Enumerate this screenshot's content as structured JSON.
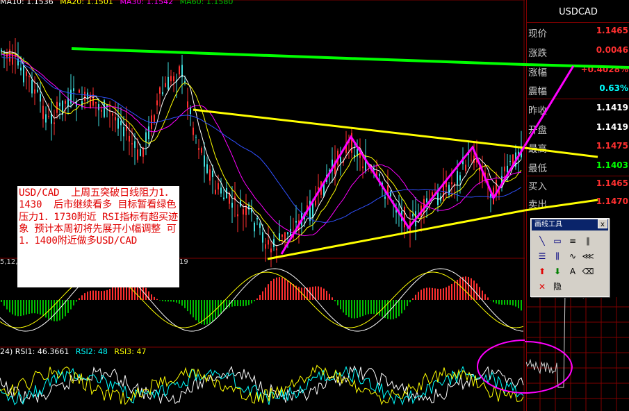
{
  "ma_header": [
    {
      "label": "MA10: 1.1536",
      "color": "#ffffff"
    },
    {
      "label": "MA20: 1.1501",
      "color": "#ffff00"
    },
    {
      "label": "MA30: 1.1542",
      "color": "#ff00ff"
    },
    {
      "label": "MA60: 1.1580",
      "color": "#00c000"
    }
  ],
  "macd_stub_left": "5,12,",
  "macd_stub_right": "19",
  "rsi_header": [
    {
      "label": "24) RSI1: 46.3661",
      "color": "#ffffff"
    },
    {
      "label": "RSI2: 48",
      "color": "#00ffff"
    },
    {
      "label": "RSI3: 47",
      "color": "#ffff00"
    }
  ],
  "note_text": "USD/CAD  上周五突破日线阻力1．1430  后市继续看多 目标暂看绿色压力1．1730附近 RSI指标有超买迹象 预计本周初将先展开小幅调整 可1．1400附近做多USD/CAD",
  "panel": {
    "symbol": "USDCAD",
    "rows": [
      {
        "label": "现价",
        "value": "1.1465",
        "color": "#ff3030"
      },
      {
        "label": "涨跌",
        "value": "0.0046",
        "color": "#ff3030"
      },
      {
        "label": "涨幅",
        "value": "+0.4028%",
        "color": "#ff3030"
      },
      {
        "label": "震幅",
        "value": "0.63%",
        "color": "#00ffff"
      },
      {
        "label": "昨收",
        "value": "1.1419",
        "color": "#ffffff"
      },
      {
        "label": "开盘",
        "value": "1.1419",
        "color": "#ffffff"
      },
      {
        "label": "最高",
        "value": "1.1475",
        "color": "#ff3030"
      },
      {
        "label": "最低",
        "value": "1.1403",
        "color": "#00ff00"
      },
      {
        "label": "买入",
        "value": "1.1465",
        "color": "#ff3030"
      },
      {
        "label": "卖出",
        "value": "1.1470",
        "color": "#ff3030"
      }
    ]
  },
  "toolbox": {
    "title": "画线工具",
    "close": "x",
    "tools": [
      {
        "name": "line-tool",
        "glyph": "╲"
      },
      {
        "name": "rect-tool",
        "glyph": "▭"
      },
      {
        "name": "parallel-tool",
        "glyph": "≡"
      },
      {
        "name": "gann-tool",
        "glyph": "∥"
      },
      {
        "name": "fib-tool",
        "glyph": "☰"
      },
      {
        "name": "cycle-tool",
        "glyph": "⫼"
      },
      {
        "name": "wave-tool",
        "glyph": "∿"
      },
      {
        "name": "fan-tool",
        "glyph": "⋘"
      },
      {
        "name": "up-arrow-tool",
        "glyph": "⬆"
      },
      {
        "name": "down-arrow-tool",
        "glyph": "⬇"
      },
      {
        "name": "text-tool",
        "glyph": "A"
      },
      {
        "name": "erase-tool",
        "glyph": "⌫"
      },
      {
        "name": "delete-tool",
        "glyph": "✕"
      },
      {
        "name": "hide-tool",
        "glyph": "隐"
      }
    ]
  },
  "colors": {
    "candle_up": "#ff3030",
    "candle_down": "#40e0e0",
    "resistance_line": "#00ff00",
    "trend_lines": "#ffff00",
    "wave_lines": "#ff00ff",
    "grid": "#800000"
  }
}
